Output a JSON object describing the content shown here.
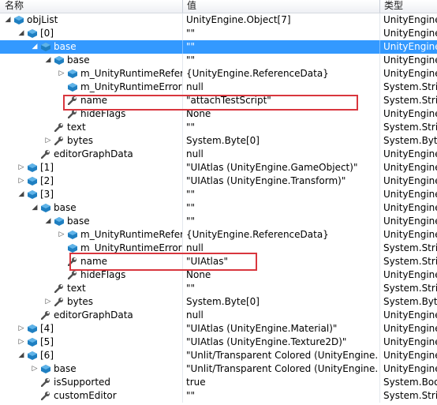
{
  "columns": {
    "name": "名称",
    "value": "值",
    "type": "类型"
  },
  "rows": [
    {
      "name": "objList",
      "value": "UnityEngine.Object[7]",
      "type": "UnityEngine.",
      "level": 0,
      "expander": "open",
      "icon": "object"
    },
    {
      "name": "[0]",
      "value": "\"\"",
      "type": "UnityEngine.",
      "level": 1,
      "expander": "open",
      "icon": "object"
    },
    {
      "name": "base",
      "value": "\"\"",
      "type": "UnityEngine.",
      "level": 2,
      "expander": "open",
      "icon": "object",
      "selected": true
    },
    {
      "name": "base",
      "value": "\"\"",
      "type": "UnityEngine.",
      "level": 3,
      "expander": "open",
      "icon": "object"
    },
    {
      "name": "m_UnityRuntimeReference",
      "value": "{UnityEngine.ReferenceData}",
      "type": "UnityEngine.",
      "level": 4,
      "expander": "closed",
      "icon": "object"
    },
    {
      "name": "m_UnityRuntimeErrorString",
      "value": "null",
      "type": "System.String",
      "level": 4,
      "expander": "none",
      "icon": "object"
    },
    {
      "name": "name",
      "value": "\"attachTestScript\"",
      "type": "System.String",
      "level": 4,
      "expander": "none",
      "icon": "wrench"
    },
    {
      "name": "hideFlags",
      "value": "None",
      "type": "UnityEngine.",
      "level": 4,
      "expander": "none",
      "icon": "wrench"
    },
    {
      "name": "text",
      "value": "\"\"",
      "type": "System.String",
      "level": 3,
      "expander": "none",
      "icon": "wrench"
    },
    {
      "name": "bytes",
      "value": "System.Byte[0]",
      "type": "System.Byte[]",
      "level": 3,
      "expander": "closed",
      "icon": "wrench"
    },
    {
      "name": "editorGraphData",
      "value": "null",
      "type": "UnityEngine.",
      "level": 2,
      "expander": "none",
      "icon": "wrench"
    },
    {
      "name": "[1]",
      "value": "\"UIAtlas (UnityEngine.GameObject)\"",
      "type": "UnityEngine.",
      "level": 1,
      "expander": "closed",
      "icon": "object"
    },
    {
      "name": "[2]",
      "value": "\"UIAtlas (UnityEngine.Transform)\"",
      "type": "UnityEngine.",
      "level": 1,
      "expander": "closed",
      "icon": "object"
    },
    {
      "name": "[3]",
      "value": "\"\"",
      "type": "UnityEngine.",
      "level": 1,
      "expander": "open",
      "icon": "object"
    },
    {
      "name": "base",
      "value": "\"\"",
      "type": "UnityEngine.",
      "level": 2,
      "expander": "open",
      "icon": "object"
    },
    {
      "name": "base",
      "value": "\"\"",
      "type": "UnityEngine.",
      "level": 3,
      "expander": "open",
      "icon": "object"
    },
    {
      "name": "m_UnityRuntimeReference",
      "value": "{UnityEngine.ReferenceData}",
      "type": "UnityEngine.",
      "level": 4,
      "expander": "closed",
      "icon": "object"
    },
    {
      "name": "m_UnityRuntimeErrorString",
      "value": "null",
      "type": "System.String",
      "level": 4,
      "expander": "none",
      "icon": "object"
    },
    {
      "name": "name",
      "value": "\"UIAtlas\"",
      "type": "System.String",
      "level": 4,
      "expander": "none",
      "icon": "wrench"
    },
    {
      "name": "hideFlags",
      "value": "None",
      "type": "UnityEngine.",
      "level": 4,
      "expander": "none",
      "icon": "wrench"
    },
    {
      "name": "text",
      "value": "\"\"",
      "type": "System.String",
      "level": 3,
      "expander": "none",
      "icon": "wrench"
    },
    {
      "name": "bytes",
      "value": "System.Byte[0]",
      "type": "System.Byte[]",
      "level": 3,
      "expander": "closed",
      "icon": "wrench"
    },
    {
      "name": "editorGraphData",
      "value": "null",
      "type": "UnityEngine.",
      "level": 2,
      "expander": "none",
      "icon": "wrench"
    },
    {
      "name": "[4]",
      "value": "\"UIAtlas (UnityEngine.Material)\"",
      "type": "UnityEngine.",
      "level": 1,
      "expander": "closed",
      "icon": "object"
    },
    {
      "name": "[5]",
      "value": "\"UIAtlas (UnityEngine.Texture2D)\"",
      "type": "UnityEngine.",
      "level": 1,
      "expander": "closed",
      "icon": "object"
    },
    {
      "name": "[6]",
      "value": "\"Unlit/Transparent Colored (UnityEngine.Shader)\"",
      "type": "UnityEngine.",
      "level": 1,
      "expander": "open",
      "icon": "object"
    },
    {
      "name": "base",
      "value": "\"Unlit/Transparent Colored (UnityEngine.Shader)\"",
      "type": "UnityEngine.",
      "level": 2,
      "expander": "closed",
      "icon": "object"
    },
    {
      "name": "isSupported",
      "value": "true",
      "type": "System.Boolean",
      "level": 2,
      "expander": "none",
      "icon": "wrench"
    },
    {
      "name": "customEditor",
      "value": "\"\"",
      "type": "System.String",
      "level": 2,
      "expander": "none",
      "icon": "wrench"
    }
  ],
  "colors": {
    "selection": "#3399ff",
    "highlight_box": "#d9363e",
    "object_icon": "#1f7fc1",
    "wrench_icon": "#505050"
  }
}
